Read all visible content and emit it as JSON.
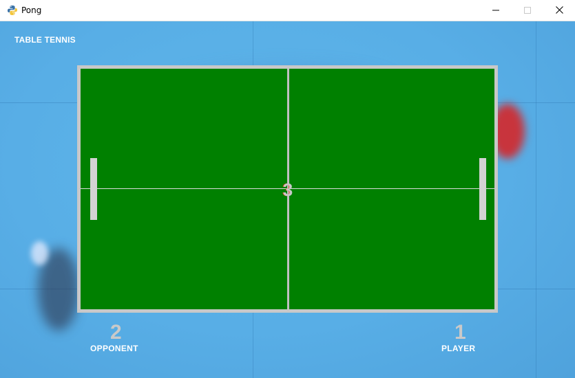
{
  "window": {
    "title": "Pong",
    "icon": "python-icon",
    "controls": [
      "minimize-icon",
      "maximize-icon",
      "close-icon"
    ]
  },
  "game": {
    "caption": "TABLE TENNIS",
    "ball_text": "3",
    "colors": {
      "table": "#008000",
      "table_border": "#c8c8c8",
      "paddles": "#d3d3d3",
      "background": "#58aee6",
      "text": "#ffffff",
      "score": "#c9c9c9"
    },
    "opponent": {
      "score": "2",
      "label": "OPPONENT"
    },
    "player": {
      "score": "1",
      "label": "PLAYER"
    }
  }
}
